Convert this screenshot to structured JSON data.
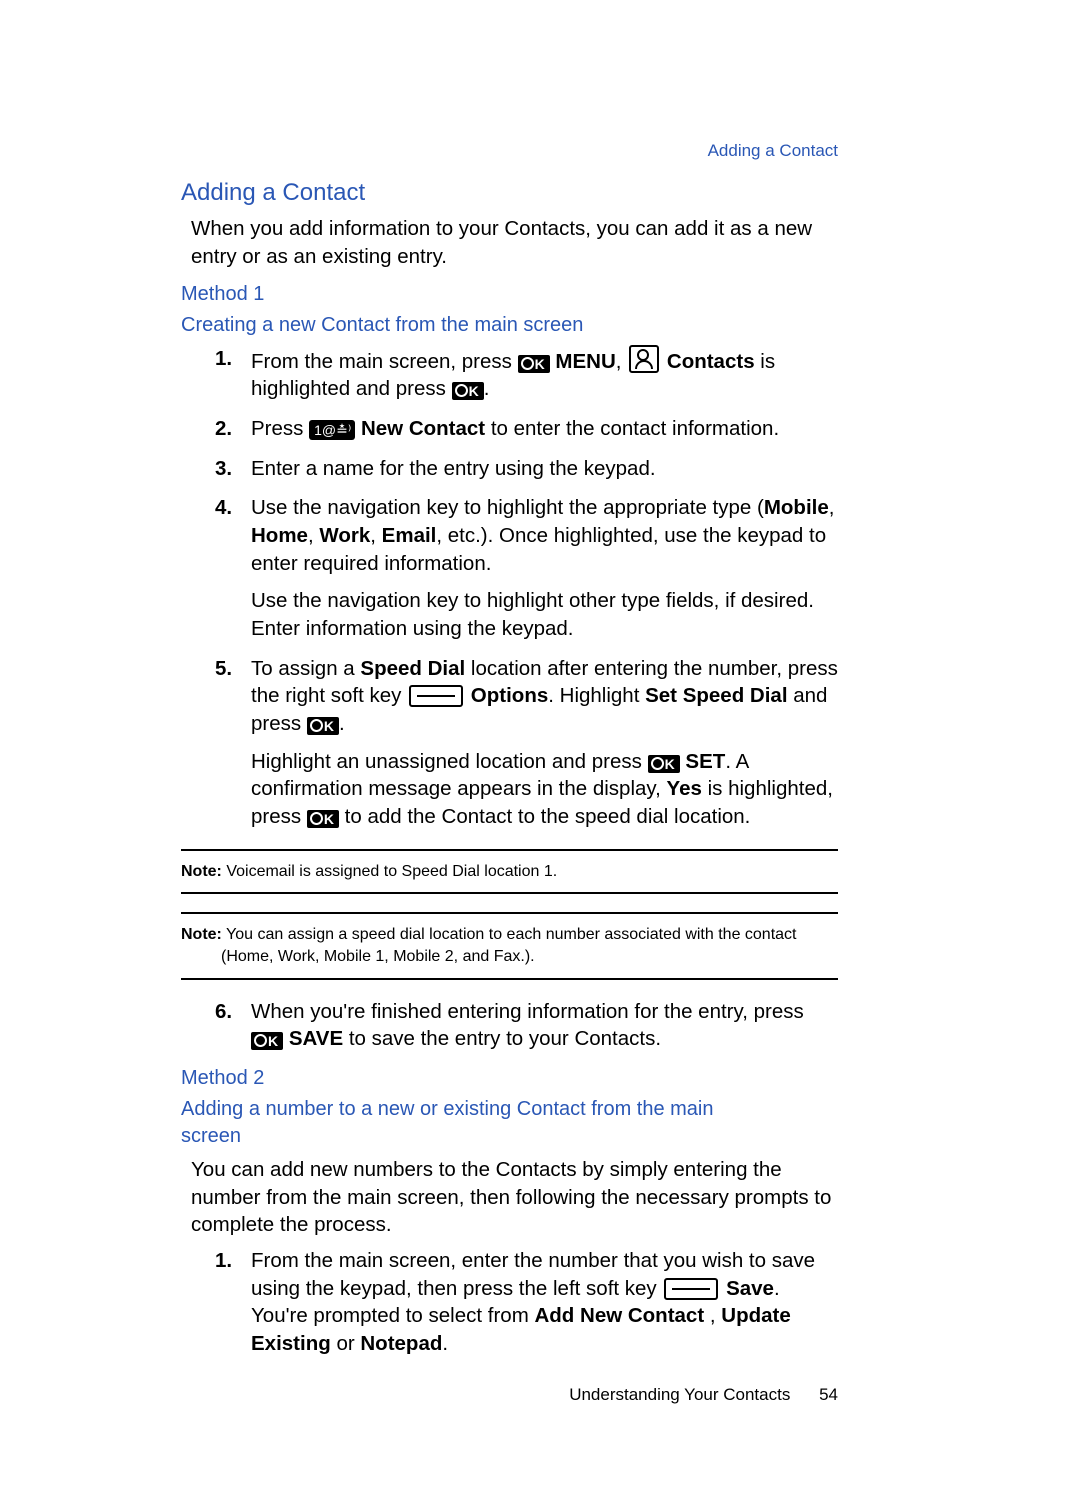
{
  "header": {
    "link": "Adding a Contact"
  },
  "title": "Adding a Contact",
  "intro": "When you add information to your Contacts, you can add it as a new entry or as an existing entry.",
  "method1": {
    "heading": "Method 1",
    "sub": "Creating a new Contact from the main screen",
    "steps": {
      "n1": "1.",
      "s1a": "From the main screen, press ",
      "s1b": " MENU",
      "s1c": ", ",
      "s1d": " Contacts",
      "s1e": " is highlighted and press ",
      "s1f": ".",
      "n2": "2.",
      "s2a": "Press ",
      "s2b": " New Contact",
      "s2c": " to enter the contact information.",
      "n3": "3.",
      "s3": "Enter a name for the entry using the keypad.",
      "n4": "4.",
      "s4a": "Use the navigation key to highlight the appropriate type (",
      "s4b": "Mobile",
      "s4c": ", ",
      "s4d": "Home",
      "s4e": ", ",
      "s4f": "Work",
      "s4g": ", ",
      "s4h": "Email",
      "s4i": ", etc.). Once highlighted, use the keypad to enter required information.",
      "s4p2": "Use the navigation key to highlight other type fields, if desired. Enter information using the keypad.",
      "n5": "5.",
      "s5a": "To assign a ",
      "s5b": "Speed Dial",
      "s5c": " location after entering the number, press the right soft key ",
      "s5d": " Options",
      "s5e": ". Highlight ",
      "s5f": "Set Speed Dial",
      "s5g": " and press ",
      "s5h": ".",
      "s5p2a": "Highlight an unassigned location and press ",
      "s5p2b": " SET",
      "s5p2c": ". A confirmation message appears in the display, ",
      "s5p2d": "Yes",
      "s5p2e": " is highlighted, press ",
      "s5p2f": " to add the Contact to the speed dial location.",
      "n6": "6.",
      "s6a": "When you're finished entering information for the entry, press ",
      "s6b": " SAVE",
      "s6c": " to save the entry to your Contacts."
    }
  },
  "notes": {
    "label": "Note:",
    "n1": " Voicemail is assigned to Speed Dial location 1.",
    "n2": " You can assign a speed dial location to each number associated with the contact (Home, Work, Mobile 1, Mobile 2, and Fax.)."
  },
  "method2": {
    "heading": "Method 2",
    "sub": "Adding a number to a new or existing Contact from the main screen",
    "intro": "You can add new numbers to the Contacts by simply entering the number from the main screen, then following the necessary prompts to complete the process.",
    "n1": "1.",
    "s1a": "From the main screen, enter the number that you wish to save using the keypad, then press the left soft key ",
    "s1b": " Save",
    "s1c": ". You're prompted to select from ",
    "s1d": "Add New Contact",
    "s1e": " , ",
    "s1f": "Update Existing",
    "s1g": " or ",
    "s1h": "Notepad",
    "s1i": "."
  },
  "footer": {
    "section": "Understanding Your Contacts",
    "page": "54"
  },
  "keylabels": {
    "ok": "K",
    "one": "1@≛⁾"
  }
}
